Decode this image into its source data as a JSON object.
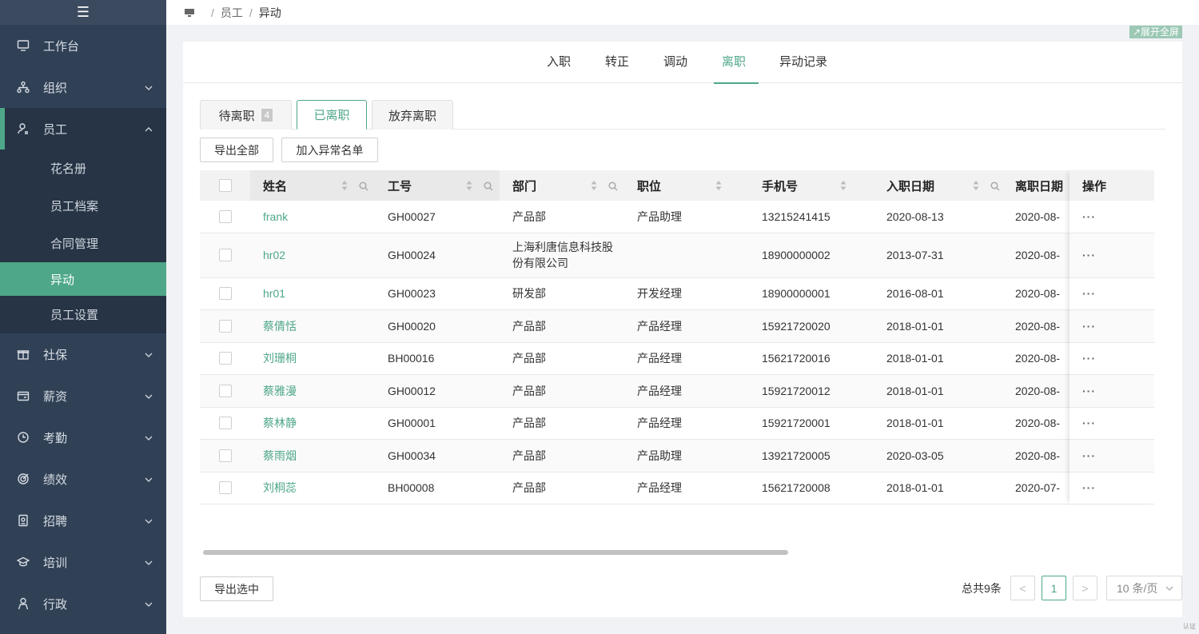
{
  "sidebar": {
    "items": [
      {
        "label": "工作台",
        "icon": "monitor-icon"
      },
      {
        "label": "组织",
        "icon": "org-icon"
      },
      {
        "label": "员工",
        "icon": "user-icon"
      },
      {
        "label": "社保",
        "icon": "gift-icon"
      },
      {
        "label": "薪资",
        "icon": "wallet-icon"
      },
      {
        "label": "考勤",
        "icon": "clock-icon"
      },
      {
        "label": "绩效",
        "icon": "target-icon"
      },
      {
        "label": "招聘",
        "icon": "badge-icon"
      },
      {
        "label": "培训",
        "icon": "graduation-icon"
      },
      {
        "label": "行政",
        "icon": "person-icon"
      }
    ],
    "employee_sub": [
      {
        "label": "花名册"
      },
      {
        "label": "员工档案"
      },
      {
        "label": "合同管理"
      },
      {
        "label": "异动"
      },
      {
        "label": "员工设置"
      }
    ]
  },
  "breadcrumb": {
    "level1": "员工",
    "level2": "异动",
    "sep": "/"
  },
  "fullscreen_label": "↗展开全屏",
  "tabs": [
    {
      "label": "入职"
    },
    {
      "label": "转正"
    },
    {
      "label": "调动"
    },
    {
      "label": "离职"
    },
    {
      "label": "异动记录"
    }
  ],
  "subtabs": {
    "pending": "待离职",
    "pending_count": "4",
    "left": "已离职",
    "abandoned": "放弃离职"
  },
  "actions": {
    "export_all": "导出全部",
    "add_abnormal": "加入异常名单",
    "export_selected": "导出选中"
  },
  "table": {
    "headers": {
      "name": "姓名",
      "code": "工号",
      "dept": "部门",
      "position": "职位",
      "phone": "手机号",
      "join_date": "入职日期",
      "leave_date": "离职日期",
      "ops": "操作"
    },
    "rows": [
      {
        "name": "frank",
        "code": "GH00027",
        "dept": "产品部",
        "position": "产品助理",
        "phone": "13215241415",
        "join": "2020-08-13",
        "leave": "2020-08-"
      },
      {
        "name": "hr02",
        "code": "GH00024",
        "dept": "上海利唐信息科技股份有限公司",
        "position": "",
        "phone": "18900000002",
        "join": "2013-07-31",
        "leave": "2020-08-"
      },
      {
        "name": "hr01",
        "code": "GH00023",
        "dept": "研发部",
        "position": "开发经理",
        "phone": "18900000001",
        "join": "2016-08-01",
        "leave": "2020-08-"
      },
      {
        "name": "蔡倩恬",
        "code": "GH00020",
        "dept": "产品部",
        "position": "产品经理",
        "phone": "15921720020",
        "join": "2018-01-01",
        "leave": "2020-08-"
      },
      {
        "name": "刘珊桐",
        "code": "BH00016",
        "dept": "产品部",
        "position": "产品经理",
        "phone": "15621720016",
        "join": "2018-01-01",
        "leave": "2020-08-"
      },
      {
        "name": "蔡雅漫",
        "code": "GH00012",
        "dept": "产品部",
        "position": "产品经理",
        "phone": "15921720012",
        "join": "2018-01-01",
        "leave": "2020-08-"
      },
      {
        "name": "蔡林静",
        "code": "GH00001",
        "dept": "产品部",
        "position": "产品经理",
        "phone": "15921720001",
        "join": "2018-01-01",
        "leave": "2020-08-"
      },
      {
        "name": "蔡雨烟",
        "code": "GH00034",
        "dept": "产品部",
        "position": "产品助理",
        "phone": "13921720005",
        "join": "2020-03-05",
        "leave": "2020-08-"
      },
      {
        "name": "刘桐蕊",
        "code": "BH00008",
        "dept": "产品部",
        "position": "产品经理",
        "phone": "15621720008",
        "join": "2018-01-01",
        "leave": "2020-07-"
      }
    ],
    "ops_label": "···"
  },
  "pagination": {
    "total": "总共9条",
    "prev": "<",
    "page": "1",
    "next": ">",
    "page_size": "10 条/页"
  },
  "corner_mark": "认证",
  "colors": {
    "sidebar_bg": "#304156",
    "accent": "#4ea788"
  }
}
